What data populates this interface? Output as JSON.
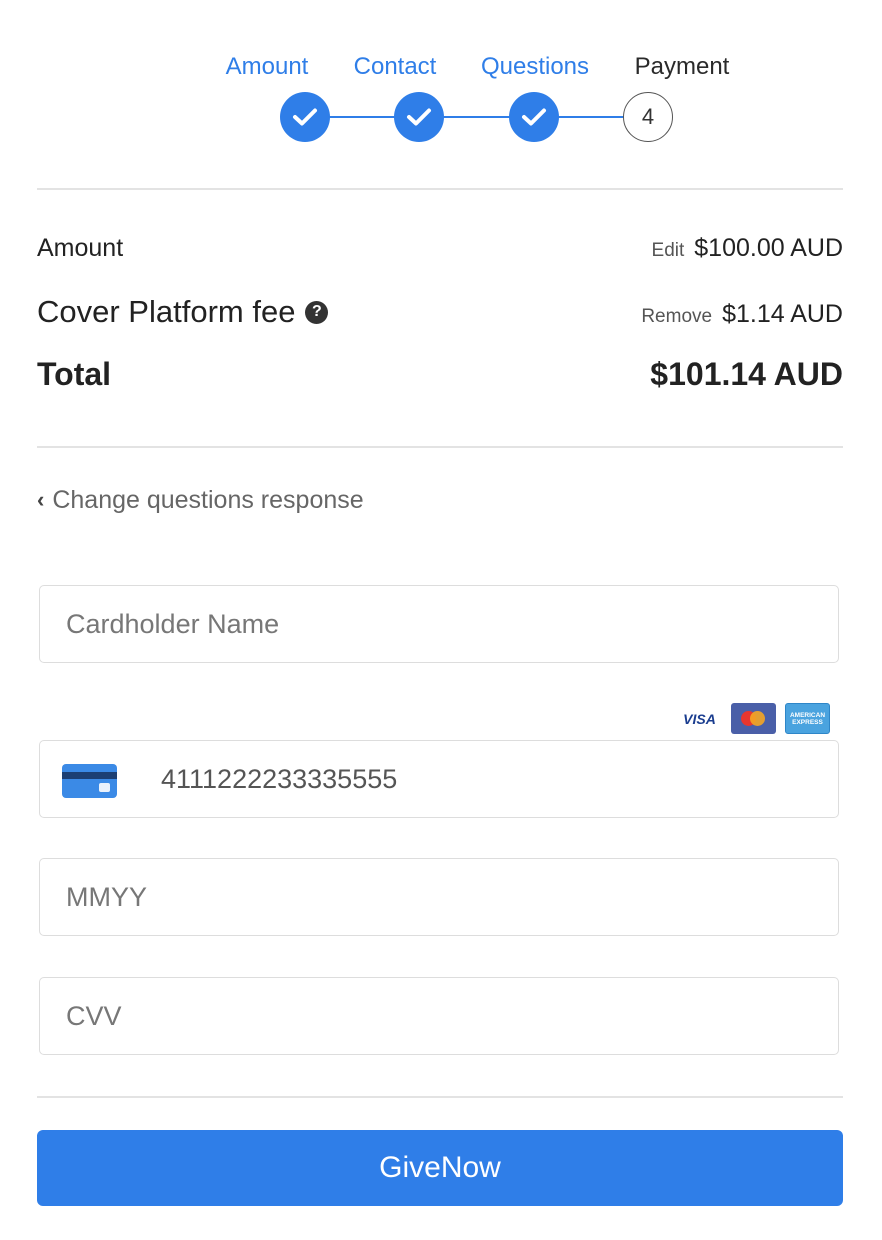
{
  "stepper": {
    "steps": [
      {
        "label": "Amount",
        "state": "done"
      },
      {
        "label": "Contact",
        "state": "done"
      },
      {
        "label": "Questions",
        "state": "done"
      },
      {
        "label": "Payment",
        "state": "current",
        "number": "4"
      }
    ],
    "accent_color": "#2f7ee8"
  },
  "summary": {
    "amount": {
      "label": "Amount",
      "action": "Edit",
      "value": "$100.00 AUD"
    },
    "fee": {
      "label": "Cover Platform fee",
      "help_icon": "?",
      "action": "Remove",
      "value": "$1.14 AUD"
    },
    "total": {
      "label": "Total",
      "value": "$101.14 AUD"
    }
  },
  "back_link": {
    "icon": "chevron-left-icon",
    "label": "Change questions response"
  },
  "form": {
    "cardholder": {
      "placeholder": "Cardholder Name",
      "value": ""
    },
    "card_brands": [
      {
        "name": "visa",
        "label": "VISA"
      },
      {
        "name": "mastercard",
        "label": ""
      },
      {
        "name": "amex",
        "label": "AMERICAN EXPRESS"
      }
    ],
    "card_number": {
      "placeholder": "",
      "value": "4111222233335555"
    },
    "expiry": {
      "placeholder": "MMYY",
      "value": ""
    },
    "cvv": {
      "placeholder": "CVV",
      "value": ""
    }
  },
  "submit": {
    "label": "GiveNow",
    "color": "#2f7ee8"
  }
}
